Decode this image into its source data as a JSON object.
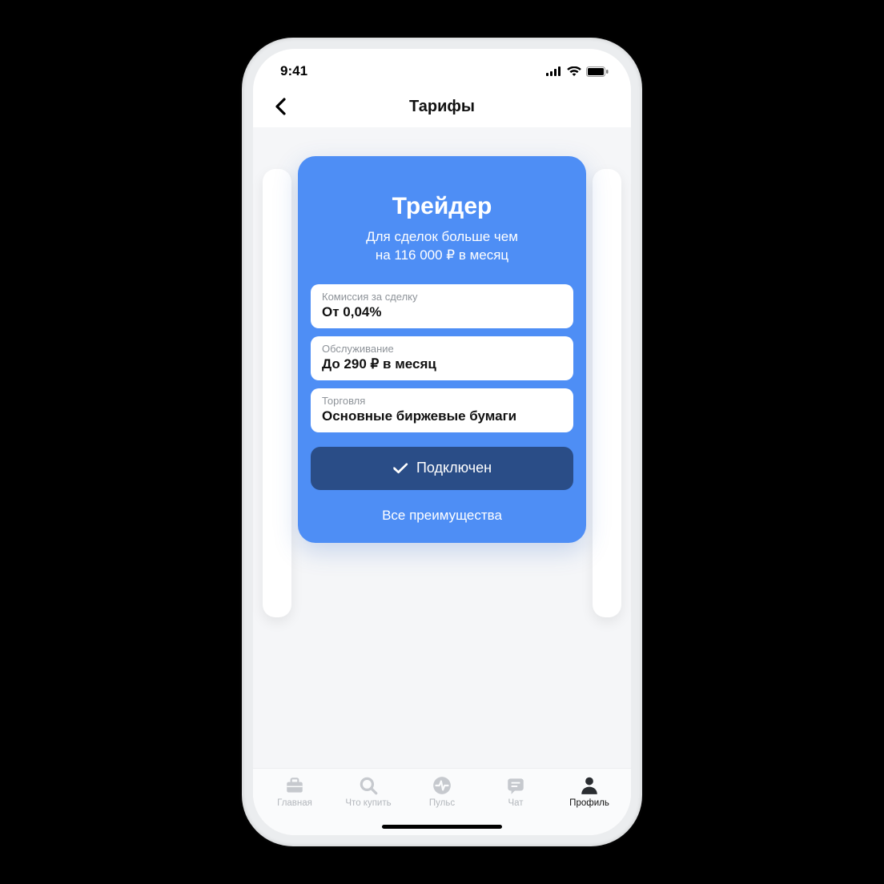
{
  "status": {
    "time": "9:41"
  },
  "header": {
    "title": "Тарифы"
  },
  "card": {
    "title": "Трейдер",
    "subtitle": "Для сделок больше чем\nна 116 000 ₽ в месяц",
    "rows": [
      {
        "label": "Комиссия за сделку",
        "value": "От 0,04%"
      },
      {
        "label": "Обслуживание",
        "value": "До 290 ₽ в месяц"
      },
      {
        "label": "Торговля",
        "value": "Основные биржевые бумаги"
      }
    ],
    "connected_label": "Подключен",
    "benefits_label": "Все преимущества"
  },
  "tabs": [
    {
      "label": "Главная"
    },
    {
      "label": "Что купить"
    },
    {
      "label": "Пульс"
    },
    {
      "label": "Чат"
    },
    {
      "label": "Профиль"
    }
  ],
  "active_tab": 4
}
